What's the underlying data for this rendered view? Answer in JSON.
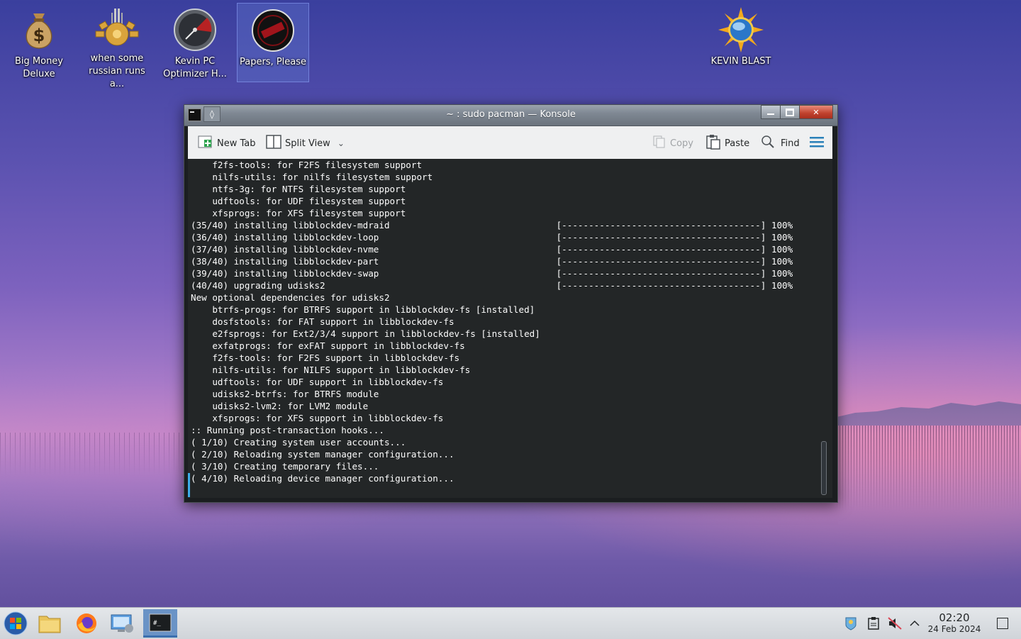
{
  "desktop": {
    "icons": [
      {
        "label": "Big Money Deluxe",
        "icon": "money-bag-icon"
      },
      {
        "label": "when some russian runs a...",
        "icon": "gear-crown-icon"
      },
      {
        "label": "Kevin PC Optimizer H...",
        "icon": "gauge-icon"
      },
      {
        "label": "Papers, Please",
        "icon": "red-stamp-disc-icon"
      },
      {
        "label": "KEVIN BLAST",
        "icon": "sun-globe-icon"
      }
    ]
  },
  "window": {
    "title": "~ : sudo pacman — Konsole",
    "toolbar": {
      "new_tab": "New Tab",
      "split_view": "Split View",
      "copy": "Copy",
      "paste": "Paste",
      "find": "Find"
    },
    "terminal_lines": [
      "    f2fs-tools: for F2FS filesystem support",
      "    nilfs-utils: for nilfs filesystem support",
      "    ntfs-3g: for NTFS filesystem support",
      "    udftools: for UDF filesystem support",
      "    xfsprogs: for XFS filesystem support",
      "(35/40) installing libblockdev-mdraid                               [-------------------------------------] 100%",
      "(36/40) installing libblockdev-loop                                 [-------------------------------------] 100%",
      "(37/40) installing libblockdev-nvme                                 [-------------------------------------] 100%",
      "(38/40) installing libblockdev-part                                 [-------------------------------------] 100%",
      "(39/40) installing libblockdev-swap                                 [-------------------------------------] 100%",
      "(40/40) upgrading udisks2                                           [-------------------------------------] 100%",
      "New optional dependencies for udisks2",
      "    btrfs-progs: for BTRFS support in libblockdev-fs [installed]",
      "    dosfstools: for FAT support in libblockdev-fs",
      "    e2fsprogs: for Ext2/3/4 support in libblockdev-fs [installed]",
      "    exfatprogs: for exFAT support in libblockdev-fs",
      "    f2fs-tools: for F2FS support in libblockdev-fs",
      "    nilfs-utils: for NILFS support in libblockdev-fs",
      "    udftools: for UDF support in libblockdev-fs",
      "    udisks2-btrfs: for BTRFS module",
      "    udisks2-lvm2: for LVM2 module",
      "    xfsprogs: for XFS support in libblockdev-fs",
      ":: Running post-transaction hooks...",
      "( 1/10) Creating system user accounts...",
      "( 2/10) Reloading system manager configuration...",
      "( 3/10) Creating temporary files...",
      "( 4/10) Reloading device manager configuration..."
    ]
  },
  "taskbar": {
    "apps": [
      "start-orb-icon",
      "file-manager-icon",
      "firefox-icon",
      "system-settings-icon",
      "konsole-icon"
    ],
    "active_app": "konsole-icon",
    "tray": [
      "kevin-tray-icon",
      "clipboard-icon",
      "muted-speaker-icon",
      "chevron-up-icon"
    ],
    "time": "02:20",
    "date": "24 Feb 2024"
  },
  "colors": {
    "terminal_bg": "#232627",
    "terminal_fg": "#fcfcfc",
    "accent": "#3daee9",
    "close_button": "#c0412d"
  }
}
